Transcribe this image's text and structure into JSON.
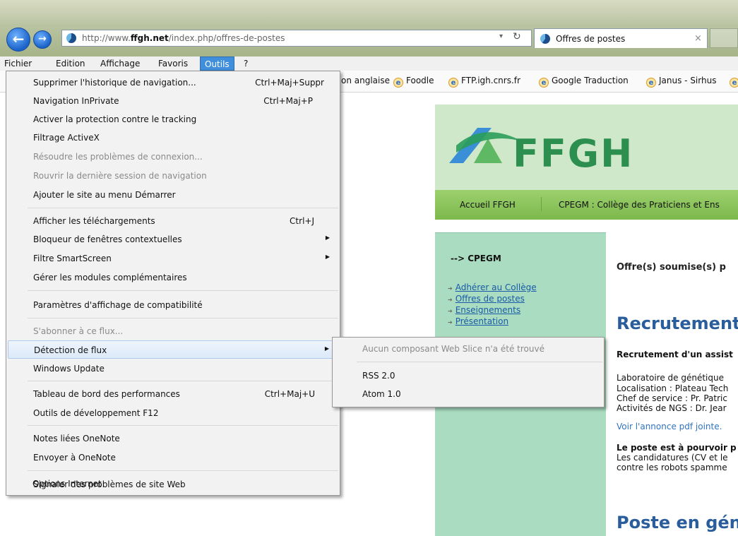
{
  "browser": {
    "address": {
      "prefix": "http://www.",
      "domain": "ffgh.net",
      "path": "/index.php/offres-de-postes"
    },
    "dropdown_glyph": "▾",
    "refresh_glyph": "↻",
    "tab": {
      "title": "Offres de postes",
      "close": "×"
    },
    "nav_icons": [
      "back-arrow-icon",
      "forward-arrow-icon",
      "site-icon"
    ]
  },
  "menubar": [
    "Fichier",
    "Edition",
    "Affichage",
    "Favoris",
    "Outils",
    "?"
  ],
  "favorites": [
    "on anglaise",
    "Foodle",
    "FTP.igh.cnrs.fr",
    "Google Traduction",
    "Janus - Sirhus"
  ],
  "tools_menu": {
    "items": [
      {
        "label": "Supprimer l'historique de navigation...",
        "shortcut": "Ctrl+Maj+Suppr"
      },
      {
        "label": "Navigation InPrivate",
        "shortcut": "Ctrl+Maj+P"
      },
      {
        "label": "Activer la protection contre le tracking",
        "shortcut": ""
      },
      {
        "label": "Filtrage ActiveX",
        "shortcut": ""
      },
      {
        "label": "Résoudre les problèmes de connexion...",
        "shortcut": ""
      },
      {
        "label": "Rouvrir la dernière session de navigation",
        "shortcut": ""
      },
      {
        "label": "Ajouter le site au menu Démarrer",
        "shortcut": ""
      },
      {
        "label": "Afficher les téléchargements",
        "shortcut": "Ctrl+J"
      },
      {
        "label": "Bloqueur de fenêtres contextuelles",
        "shortcut": ""
      },
      {
        "label": "Filtre SmartScreen",
        "shortcut": ""
      },
      {
        "label": "Gérer les modules complémentaires",
        "shortcut": ""
      },
      {
        "label": "Paramètres d'affichage de compatibilité",
        "shortcut": ""
      },
      {
        "label": "S'abonner à ce flux...",
        "shortcut": ""
      },
      {
        "label": "Détection de flux",
        "shortcut": ""
      },
      {
        "label": "Windows Update",
        "shortcut": ""
      },
      {
        "label": "Tableau de bord des performances",
        "shortcut": "Ctrl+Maj+U"
      },
      {
        "label": "Outils de développement F12",
        "shortcut": ""
      },
      {
        "label": "Notes liées OneNote",
        "shortcut": ""
      },
      {
        "label": "Envoyer à OneNote",
        "shortcut": ""
      },
      {
        "label": "Signaler des problèmes de site Web",
        "shortcut": ""
      },
      {
        "label": "Options Internet",
        "shortcut": ""
      }
    ],
    "submenu_arrow": "▶"
  },
  "feed_submenu": {
    "items": [
      "Aucun composant Web Slice n'a été trouvé",
      "RSS 2.0",
      "Atom 1.0"
    ]
  },
  "site": {
    "logo_text": "FFGH",
    "nav": [
      "Accueil FFGH",
      "CPEGM : Collège des Praticiens et Ens"
    ],
    "sidebar": {
      "title": "--> CPEGM",
      "links": [
        "Adhérer au Collège",
        "Offres de postes",
        "Enseignements",
        "Présentation"
      ]
    },
    "content": {
      "intro": "Offre(s) soumise(s) p",
      "heading": "Recrutement",
      "subheading": "Recrutement d'un assist",
      "details": [
        "Laboratoire de génétique",
        "Localisation : Plateau Tech",
        "Chef de service : Pr. Patric",
        "Activités de NGS : Dr. Jear"
      ],
      "link": "Voir l'annonce pdf jointe.",
      "bold_line": "Le poste est à pourvoir p",
      "text": [
        "Les candidatures (CV et le",
        "contre les robots spamme"
      ],
      "heading2": "Poste en gén"
    }
  },
  "colors": {
    "menu_highlight": "#3f8fdc",
    "sidebar_bg": "#a9dcc0",
    "heading_blue": "#2a5d9c",
    "nav_green": "#8cc45d"
  }
}
